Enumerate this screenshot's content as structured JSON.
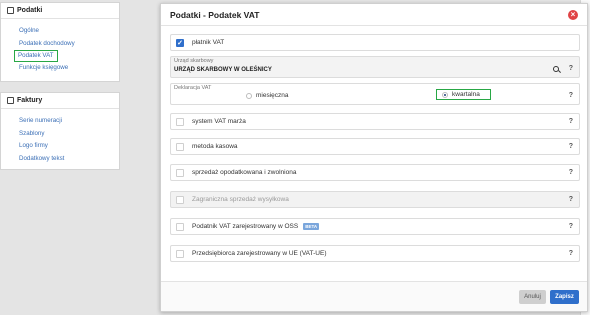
{
  "background": {
    "panels": [
      {
        "title": "Podatki",
        "items": [
          "Ogólne",
          "Podatek dochodowy",
          "Podatek VAT",
          "Funkcje księgowe"
        ],
        "active_index": 2
      },
      {
        "title": "Faktury",
        "items": [
          "Serie numeracji",
          "Szablony",
          "Logo firmy",
          "Dodatkowy tekst"
        ]
      }
    ]
  },
  "modal": {
    "title": "Podatki - Podatek VAT",
    "vat_payer": {
      "label": "płatnik VAT",
      "checked": true
    },
    "tax_office": {
      "label": "Urząd skarbowy",
      "value": "URZĄD SKARBOWY W OLEŚNICY"
    },
    "declaration": {
      "label": "Deklaracja VAT",
      "options": [
        "miesięczna",
        "kwartalna"
      ],
      "selected": "kwartalna"
    },
    "options": [
      {
        "label": "system VAT marża",
        "checked": false,
        "disabled": false
      },
      {
        "label": "metoda kasowa",
        "checked": false,
        "disabled": false
      },
      {
        "label": "sprzedaż opodatkowana i zwolniona",
        "checked": false,
        "disabled": false
      },
      {
        "label": "Zagraniczna sprzedaż wysyłkowa",
        "checked": false,
        "disabled": true
      },
      {
        "label": "Podatnik VAT zarejestrowany w OSS",
        "checked": false,
        "disabled": false,
        "badge": "BETA"
      },
      {
        "label": "Przedsiębiorca zarejestrowany w UE (VAT-UE)",
        "checked": false,
        "disabled": false
      }
    ],
    "help_glyph": "?",
    "close_glyph": "×",
    "footer": {
      "cancel": "Anuluj",
      "save": "Zapisz"
    }
  },
  "colors": {
    "accent": "#2f6fcb",
    "highlight": "#28a745",
    "close": "#e04345",
    "link": "#3b6fb6"
  }
}
